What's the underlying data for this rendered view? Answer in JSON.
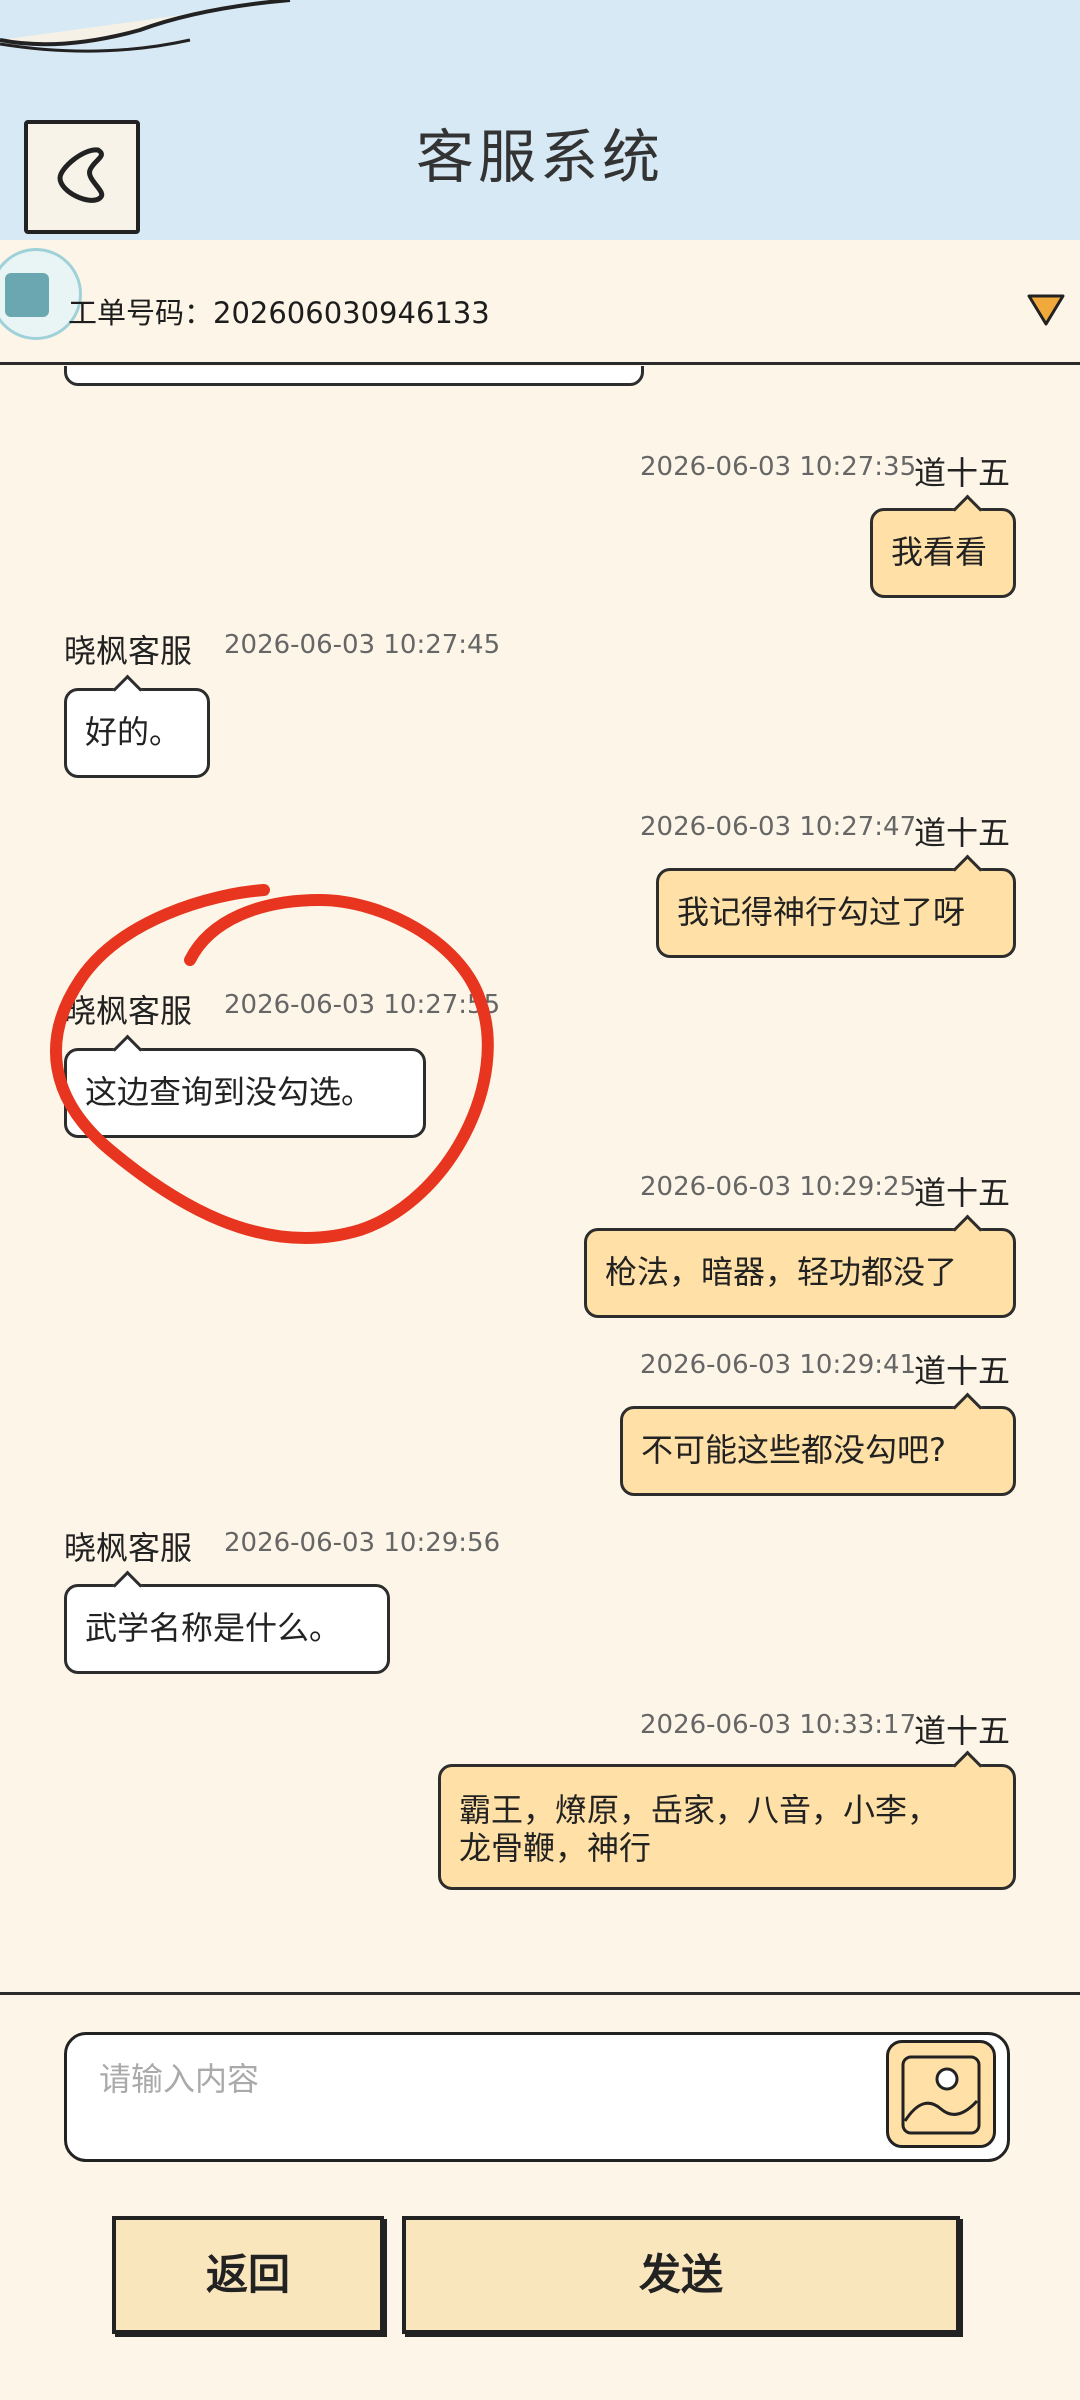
{
  "header": {
    "title": "客服系统",
    "back_icon": "chevron-left-icon"
  },
  "ticket": {
    "label": "工单号码：202606030946133",
    "dropdown_icon": "triangle-down-icon"
  },
  "messages": [
    {
      "side": "right",
      "name": "道十五",
      "time": "2026-06-03 10:27:35",
      "text": "我看看"
    },
    {
      "side": "left",
      "name": "晓枫客服",
      "time": "2026-06-03 10:27:45",
      "text": "好的。"
    },
    {
      "side": "right",
      "name": "道十五",
      "time": "2026-06-03 10:27:47",
      "text": "我记得神行勾过了呀"
    },
    {
      "side": "left",
      "name": "晓枫客服",
      "time": "2026-06-03 10:27:55",
      "text": "这边查询到没勾选。"
    },
    {
      "side": "right",
      "name": "道十五",
      "time": "2026-06-03 10:29:25",
      "text": "枪法，暗器，轻功都没了"
    },
    {
      "side": "right",
      "name": "道十五",
      "time": "2026-06-03 10:29:41",
      "text": "不可能这些都没勾吧?"
    },
    {
      "side": "left",
      "name": "晓枫客服",
      "time": "2026-06-03 10:29:56",
      "text": "武学名称是什么。"
    },
    {
      "side": "right",
      "name": "道十五",
      "time": "2026-06-03 10:33:17",
      "text_line1": "霸王，燎原，岳家，八音，小李，",
      "text_line2": "龙骨鞭，神行"
    }
  ],
  "input": {
    "placeholder": "请输入内容",
    "image_icon": "image-icon"
  },
  "buttons": {
    "back_label": "返回",
    "send_label": "发送"
  },
  "colors": {
    "header_bg": "#d6e9f5",
    "page_bg": "#fdf6e8",
    "right_bubble": "#ffe0a6",
    "left_bubble": "#ffffff",
    "annotation": "#e8351f"
  }
}
